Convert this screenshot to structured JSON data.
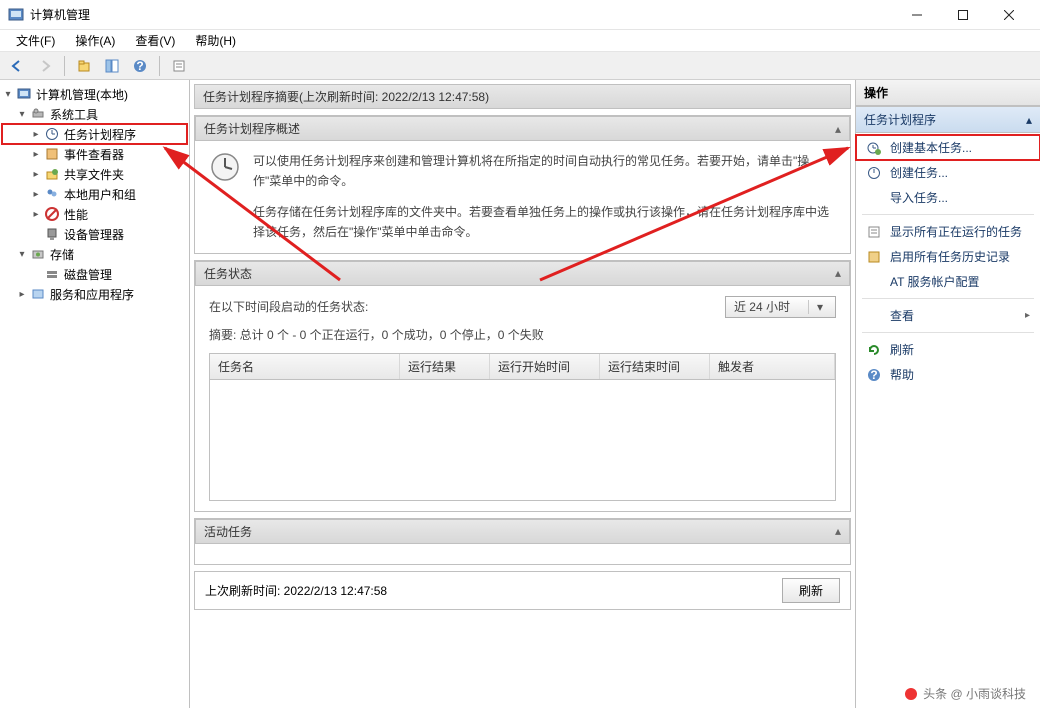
{
  "window": {
    "title": "计算机管理"
  },
  "menu": {
    "file": "文件(F)",
    "action": "操作(A)",
    "view": "查看(V)",
    "help": "帮助(H)"
  },
  "tree": {
    "root": "计算机管理(本地)",
    "system_tools": "系统工具",
    "task_scheduler": "任务计划程序",
    "event_viewer": "事件查看器",
    "shared_folders": "共享文件夹",
    "local_users": "本地用户和组",
    "performance": "性能",
    "device_manager": "设备管理器",
    "storage": "存储",
    "disk_mgmt": "磁盘管理",
    "services_apps": "服务和应用程序"
  },
  "center": {
    "summary_header": "任务计划程序摘要(上次刷新时间: 2022/2/13 12:47:58)",
    "overview_header": "任务计划程序概述",
    "overview_p1": "可以使用任务计划程序来创建和管理计算机将在所指定的时间自动执行的常见任务。若要开始，请单击\"操作\"菜单中的命令。",
    "overview_p2": "任务存储在任务计划程序库的文件夹中。若要查看单独任务上的操作或执行该操作，请在任务计划程序库中选择该任务，然后在\"操作\"菜单中单击命令。",
    "status_header": "任务状态",
    "status_line1": "在以下时间段启动的任务状态:",
    "time_range": "近 24 小时",
    "status_summary": "摘要: 总计 0 个 - 0 个正在运行，0 个成功，0 个停止，0 个失败",
    "col_name": "任务名",
    "col_result": "运行结果",
    "col_start": "运行开始时间",
    "col_end": "运行结束时间",
    "col_trigger": "触发者",
    "active_header": "活动任务",
    "footer_time": "上次刷新时间: 2022/2/13 12:47:58",
    "refresh_btn": "刷新"
  },
  "actions": {
    "pane_title": "操作",
    "group": "任务计划程序",
    "create_basic": "创建基本任务...",
    "create_task": "创建任务...",
    "import_task": "导入任务...",
    "show_running": "显示所有正在运行的任务",
    "enable_history": "启用所有任务历史记录",
    "at_service": "AT 服务帐户配置",
    "view": "查看",
    "refresh": "刷新",
    "help": "帮助"
  },
  "watermark": "头条 @ 小雨谈科技"
}
